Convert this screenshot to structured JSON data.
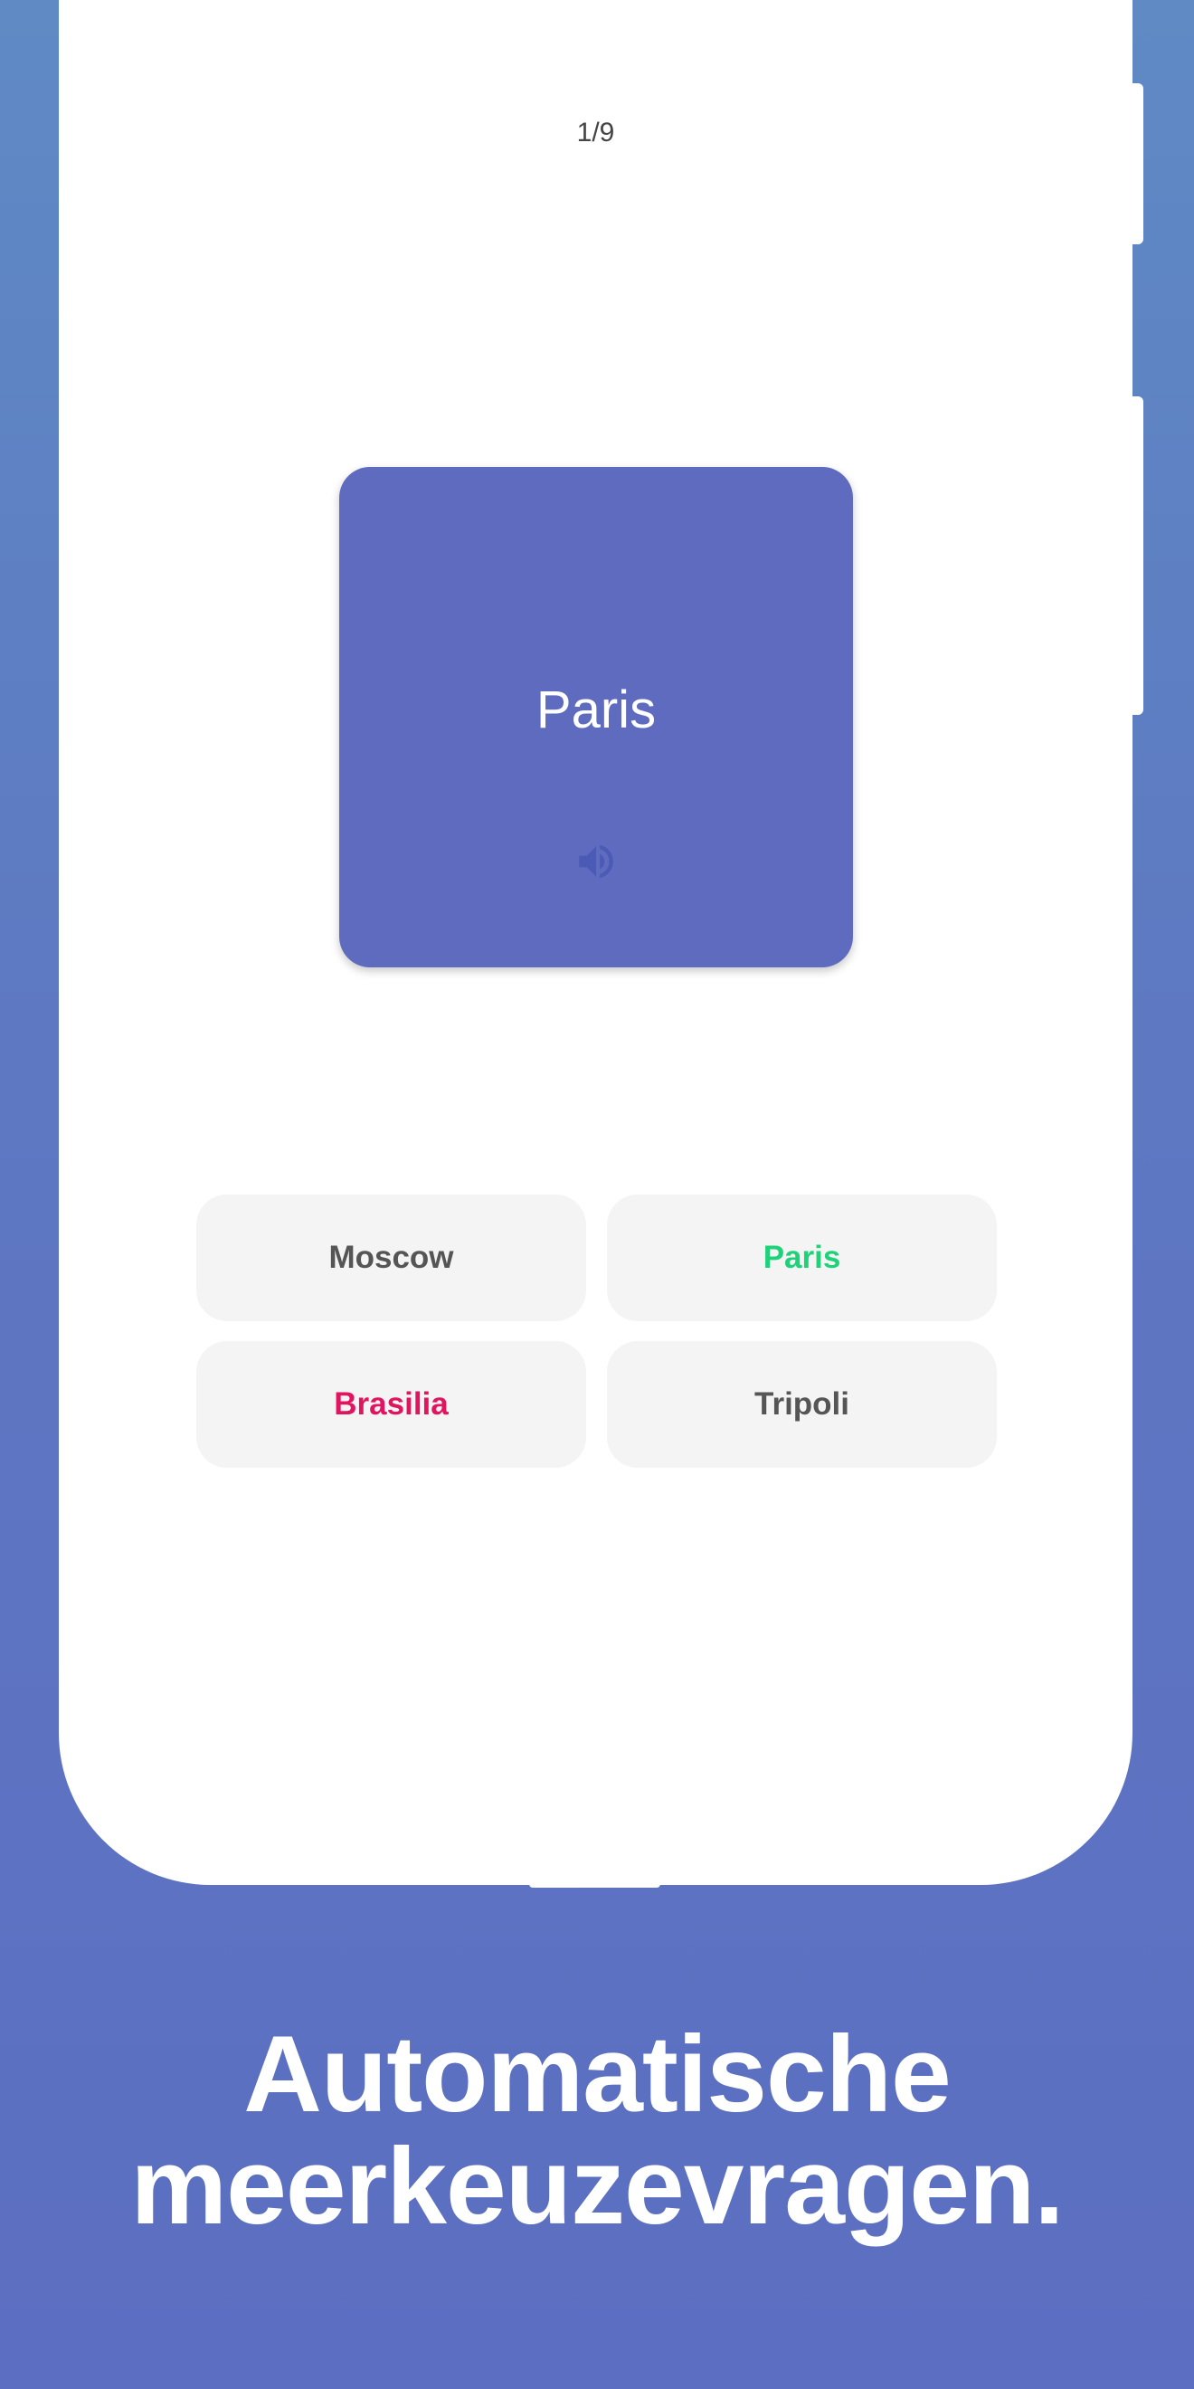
{
  "question": {
    "counter": "1/9",
    "card_word": "Paris",
    "card_color": "#5e6bbf",
    "speaker_icon": "volume-up-icon"
  },
  "answers": [
    {
      "label": "Moscow",
      "state": "neutral",
      "color": "#555555"
    },
    {
      "label": "Paris",
      "state": "correct",
      "color": "#1fd27a"
    },
    {
      "label": "Brasilia",
      "state": "incorrect",
      "color": "#e0155f"
    },
    {
      "label": "Tripoli",
      "state": "neutral",
      "color": "#555555"
    }
  ],
  "headline": {
    "line1": "Automatische",
    "line2": "meerkeuzevragen."
  }
}
